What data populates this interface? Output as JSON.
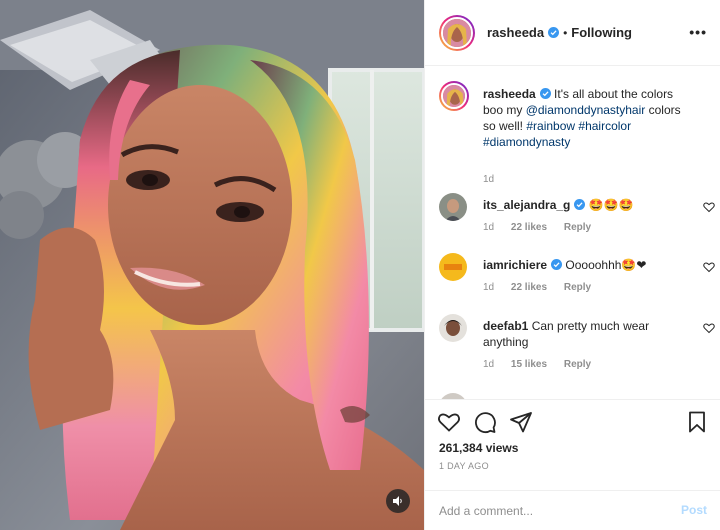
{
  "post": {
    "username": "rasheeda",
    "follow_status": "Following",
    "separator": "•",
    "more_label": "•••"
  },
  "caption": {
    "username": "rasheeda",
    "text_1": " It's all about the colors boo my ",
    "mention": "@diamonddynastyhair",
    "text_2": " colors so well! ",
    "hashtag_1": "#rainbow",
    "hashtag_2": "#haircolor",
    "hashtag_3": "#diamondynasty",
    "age": "1d"
  },
  "comments": [
    {
      "username": "its_alejandra_g",
      "text": " 🤩🤩🤩",
      "age": "1d",
      "likes": "22 likes",
      "reply": "Reply"
    },
    {
      "username": "iamrichiere",
      "text": " Ooooohhh🤩❤",
      "age": "1d",
      "likes": "22 likes",
      "reply": "Reply"
    },
    {
      "username": "deefab1",
      "text": " Can pretty much wear anything",
      "age": "1d",
      "likes": "15 likes",
      "reply": "Reply"
    }
  ],
  "stats": {
    "views": "261,384 views",
    "date": "1 DAY AGO"
  },
  "add_comment": {
    "placeholder": "Add a comment...",
    "post_label": "Post"
  },
  "colors": {
    "link": "#00376b",
    "verified": "#3897f0",
    "post_disabled": "#b3dbff",
    "muted": "#8e8e8e"
  }
}
